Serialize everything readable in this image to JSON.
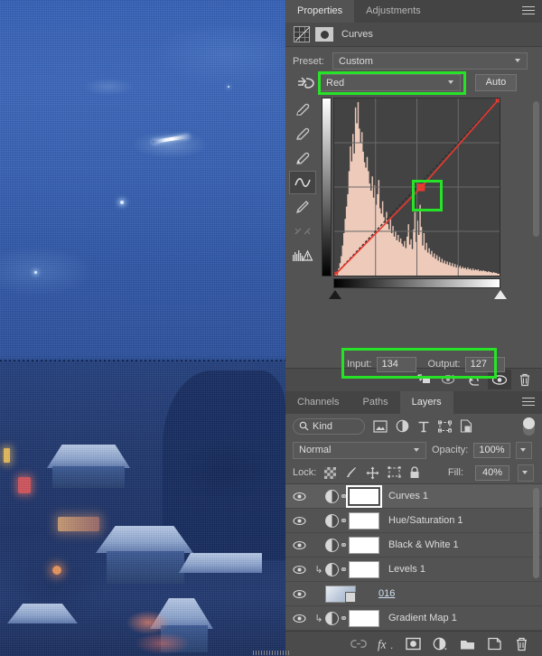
{
  "document": {
    "image_description": "snowy mountain village at blue hour, night sky"
  },
  "properties_panel": {
    "tabs": [
      {
        "label": "Properties",
        "active": true
      },
      {
        "label": "Adjustments",
        "active": false
      }
    ],
    "menu_icon": "panel-menu-icon",
    "header": {
      "adjustment_icon": "curves-adjustment-icon",
      "mask_icon": "layer-mask-icon",
      "title": "Curves"
    },
    "preset": {
      "label": "Preset:",
      "value": "Custom"
    },
    "channel": {
      "icon": "on-image-adjust-icon",
      "value": "Red",
      "highlighted": true,
      "highlight_color": "#27e327"
    },
    "auto_button": "Auto",
    "tools": [
      {
        "name": "sample-black-point-eyedropper",
        "selected": false
      },
      {
        "name": "sample-gray-point-eyedropper",
        "selected": false
      },
      {
        "name": "sample-white-point-eyedropper",
        "selected": false
      },
      {
        "name": "edit-points-curve-tool",
        "selected": true
      },
      {
        "name": "draw-curve-pencil-tool",
        "selected": false
      },
      {
        "name": "smooth-curve-tool",
        "selected": false
      },
      {
        "name": "histogram-warning-icon",
        "selected": false
      }
    ],
    "input_label": "Input:",
    "input_value": "134",
    "output_label": "Output:",
    "output_value": "127",
    "io_highlighted": true,
    "point_highlighted": true,
    "footer_buttons": [
      {
        "name": "clip-to-layer-button",
        "active": false
      },
      {
        "name": "view-previous-state-button",
        "active": false
      },
      {
        "name": "reset-adjustment-button",
        "active": false
      },
      {
        "name": "toggle-layer-visibility-button",
        "active": true
      },
      {
        "name": "delete-adjustment-layer-button",
        "active": false
      }
    ]
  },
  "chart_data": {
    "type": "line",
    "title": "Curves - Red channel",
    "xlabel": "Input",
    "ylabel": "Output",
    "xlim": [
      0,
      255
    ],
    "ylim": [
      0,
      255
    ],
    "grid": true,
    "grid_divisions": 4,
    "channel": "Red",
    "curve_color": "#e8392f",
    "baseline_color": "#2e2e2e",
    "points": [
      {
        "input": 0,
        "output": 0
      },
      {
        "input": 134,
        "output": 127
      },
      {
        "input": 255,
        "output": 255
      }
    ],
    "selected_point": {
      "input": 134,
      "output": 127
    },
    "histogram_color": "#f7d2c1",
    "histogram": [
      2,
      3,
      5,
      8,
      14,
      22,
      34,
      48,
      64,
      78,
      92,
      118,
      146,
      129,
      160,
      138,
      190,
      172,
      196,
      166,
      150,
      162,
      140,
      128,
      122,
      134,
      118,
      104,
      96,
      112,
      88,
      102,
      80,
      92,
      108,
      76,
      70,
      84,
      66,
      60,
      72,
      58,
      52,
      64,
      48,
      56,
      44,
      50,
      40,
      46,
      38,
      42,
      36,
      33,
      39,
      31,
      44,
      58,
      35,
      41,
      30,
      52,
      72,
      38,
      62,
      46,
      80,
      55,
      34,
      48,
      29,
      37,
      26,
      31,
      24,
      28,
      21,
      25,
      19,
      23,
      17,
      21,
      15,
      19,
      14,
      17,
      13,
      16,
      12,
      15,
      11,
      14,
      10,
      13,
      9,
      12,
      9,
      11,
      8,
      10,
      8,
      9,
      7,
      9,
      7,
      8,
      6,
      8,
      6,
      7,
      6,
      7,
      5,
      6,
      5,
      6,
      5,
      5,
      4,
      5,
      4,
      4,
      3,
      4,
      3,
      3,
      2,
      2
    ],
    "black_slider": 0,
    "white_slider": 255
  },
  "layers_panel": {
    "tabs": [
      {
        "label": "Channels",
        "active": false
      },
      {
        "label": "Paths",
        "active": false
      },
      {
        "label": "Layers",
        "active": true
      }
    ],
    "menu_icon": "panel-menu-icon",
    "filter": {
      "kind_label": "Kind",
      "search_icon": "search-icon",
      "icons": [
        "filter-pixel-layers-icon",
        "filter-adjustment-layers-icon",
        "filter-type-layers-icon",
        "filter-shape-layers-icon",
        "filter-smart-object-icon"
      ],
      "toggle": "filter-enable-toggle"
    },
    "blend_mode": "Normal",
    "opacity_label": "Opacity:",
    "opacity_value": "100%",
    "lock_label": "Lock:",
    "lock_icons": [
      "lock-transparent-pixels-icon",
      "lock-image-pixels-icon",
      "lock-position-icon",
      "lock-artboard-nesting-icon",
      "lock-all-icon"
    ],
    "fill_label": "Fill:",
    "fill_value": "40%",
    "layers": [
      {
        "name": "Curves 1",
        "visible": true,
        "type": "adjustment",
        "clipped": false,
        "selected": true,
        "mask_active": true
      },
      {
        "name": "Hue/Saturation 1",
        "visible": true,
        "type": "adjustment",
        "clipped": false,
        "selected": false,
        "mask_active": false
      },
      {
        "name": "Black & White 1",
        "visible": true,
        "type": "adjustment",
        "clipped": false,
        "selected": false,
        "mask_active": false
      },
      {
        "name": "Levels 1",
        "visible": true,
        "type": "adjustment",
        "clipped": true,
        "selected": false,
        "mask_active": false
      },
      {
        "name": "016",
        "visible": true,
        "type": "smart-object",
        "clipped": false,
        "selected": false,
        "mask_active": false
      },
      {
        "name": "Gradient Map 1",
        "visible": true,
        "type": "adjustment",
        "clipped": true,
        "selected": false,
        "mask_active": false
      }
    ],
    "footer_buttons": [
      {
        "name": "link-layers-button",
        "label": "link"
      },
      {
        "name": "add-layer-style-button",
        "label": "fx"
      },
      {
        "name": "add-layer-mask-button",
        "label": "mask"
      },
      {
        "name": "new-adjustment-layer-button",
        "label": "adjustment"
      },
      {
        "name": "new-group-button",
        "label": "group"
      },
      {
        "name": "new-layer-button",
        "label": "new"
      },
      {
        "name": "delete-layer-button",
        "label": "delete"
      }
    ]
  }
}
